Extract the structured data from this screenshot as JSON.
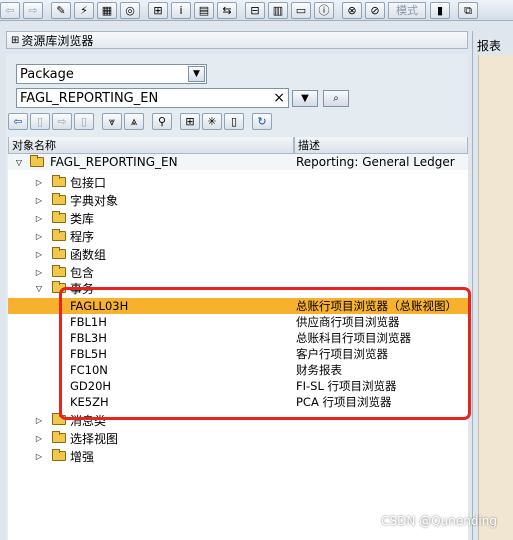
{
  "panel": {
    "title": "资源库浏览器"
  },
  "object_type": {
    "selected": "Package"
  },
  "object_name": {
    "value": "FAGL_REPORTING_EN"
  },
  "toolbar": {
    "mode_label": "模式"
  },
  "tree": {
    "columns": {
      "name": "对象名称",
      "description": "描述"
    },
    "root": {
      "name": "FAGL_REPORTING_EN",
      "description": "Reporting: General Ledger"
    },
    "folders_before": [
      "包接口",
      "字典对象",
      "类库",
      "程序",
      "函数组",
      "包含"
    ],
    "open_folder": "事务",
    "transactions": [
      {
        "code": "FAGLL03H",
        "description": "总账行项目浏览器（总账视图）",
        "selected": true
      },
      {
        "code": "FBL1H",
        "description": "供应商行项目浏览器"
      },
      {
        "code": "FBL3H",
        "description": "总账科目行项目浏览器"
      },
      {
        "code": "FBL5H",
        "description": "客户行项目浏览器"
      },
      {
        "code": "FC10N",
        "description": "财务报表"
      },
      {
        "code": "GD20H",
        "description": "FI-SL 行项目浏览器"
      },
      {
        "code": "KE5ZH",
        "description": "PCA 行项目浏览器"
      }
    ],
    "folders_after": [
      "消息类",
      "选择视图",
      "增强"
    ]
  },
  "right_panel": {
    "tab": "报表"
  },
  "watermark": "CSDN @Qunending",
  "colors": {
    "selection": "#f7b12d",
    "highlight_frame": "#e8241c",
    "folder": "#f1c84b"
  }
}
